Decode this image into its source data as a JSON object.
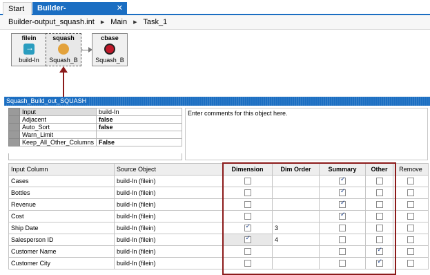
{
  "tabs": [
    {
      "label": "Start"
    },
    {
      "label": "Builder-output_squash.int*",
      "close": "✕"
    }
  ],
  "breadcrumb": [
    "Builder-output_squash.int",
    "Main",
    "Task_1"
  ],
  "canvas": {
    "nodes": [
      {
        "title": "filein",
        "label": "build-In",
        "icon": "file-input-icon"
      },
      {
        "title": "squash",
        "label": "Squash_B",
        "icon": "squash-icon"
      },
      {
        "title": "cbase",
        "label": "Squash_B",
        "icon": "cbase-icon"
      }
    ]
  },
  "panel": {
    "title": "Squash_Build_out_SQUASH",
    "comments_placeholder": "Enter comments for this object here."
  },
  "properties": [
    {
      "name": "Input",
      "value": "build-In",
      "bold": false
    },
    {
      "name": "Adjacent",
      "value": "false",
      "bold": true
    },
    {
      "name": "Auto_Sort",
      "value": "false",
      "bold": true
    },
    {
      "name": "Warn_Limit",
      "value": "",
      "bold": false
    },
    {
      "name": "Keep_All_Other_Columns",
      "value": "False",
      "bold": true
    }
  ],
  "grid": {
    "headers": {
      "input_column": "Input Column",
      "source_object": "Source Object",
      "dimension": "Dimension",
      "dim_order": "Dim Order",
      "summary": "Summary",
      "other": "Other",
      "remove": "Remove"
    },
    "rows": [
      {
        "input": "Cases",
        "source": "build-In (filein)",
        "dimension": false,
        "dim_order": "",
        "summary": true,
        "other": false,
        "remove": false
      },
      {
        "input": "Bottles",
        "source": "build-In (filein)",
        "dimension": false,
        "dim_order": "",
        "summary": true,
        "other": false,
        "remove": false
      },
      {
        "input": "Revenue",
        "source": "build-In (filein)",
        "dimension": false,
        "dim_order": "",
        "summary": true,
        "other": false,
        "remove": false
      },
      {
        "input": "Cost",
        "source": "build-In (filein)",
        "dimension": false,
        "dim_order": "",
        "summary": true,
        "other": false,
        "remove": false
      },
      {
        "input": "Ship Date",
        "source": "build-In (filein)",
        "dimension": true,
        "dim_order": "3",
        "summary": false,
        "other": false,
        "remove": false
      },
      {
        "input": "Salesperson ID",
        "source": "build-In (filein)",
        "dimension": true,
        "dim_order": "4",
        "summary": false,
        "other": false,
        "remove": false
      },
      {
        "input": "Customer Name",
        "source": "build-In (filein)",
        "dimension": false,
        "dim_order": "",
        "summary": false,
        "other": true,
        "remove": false
      },
      {
        "input": "Customer City",
        "source": "build-In (filein)",
        "dimension": false,
        "dim_order": "",
        "summary": false,
        "other": true,
        "remove": false
      }
    ]
  },
  "colors": {
    "accent": "#1b6ec2",
    "highlight": "#8b1a1a"
  }
}
